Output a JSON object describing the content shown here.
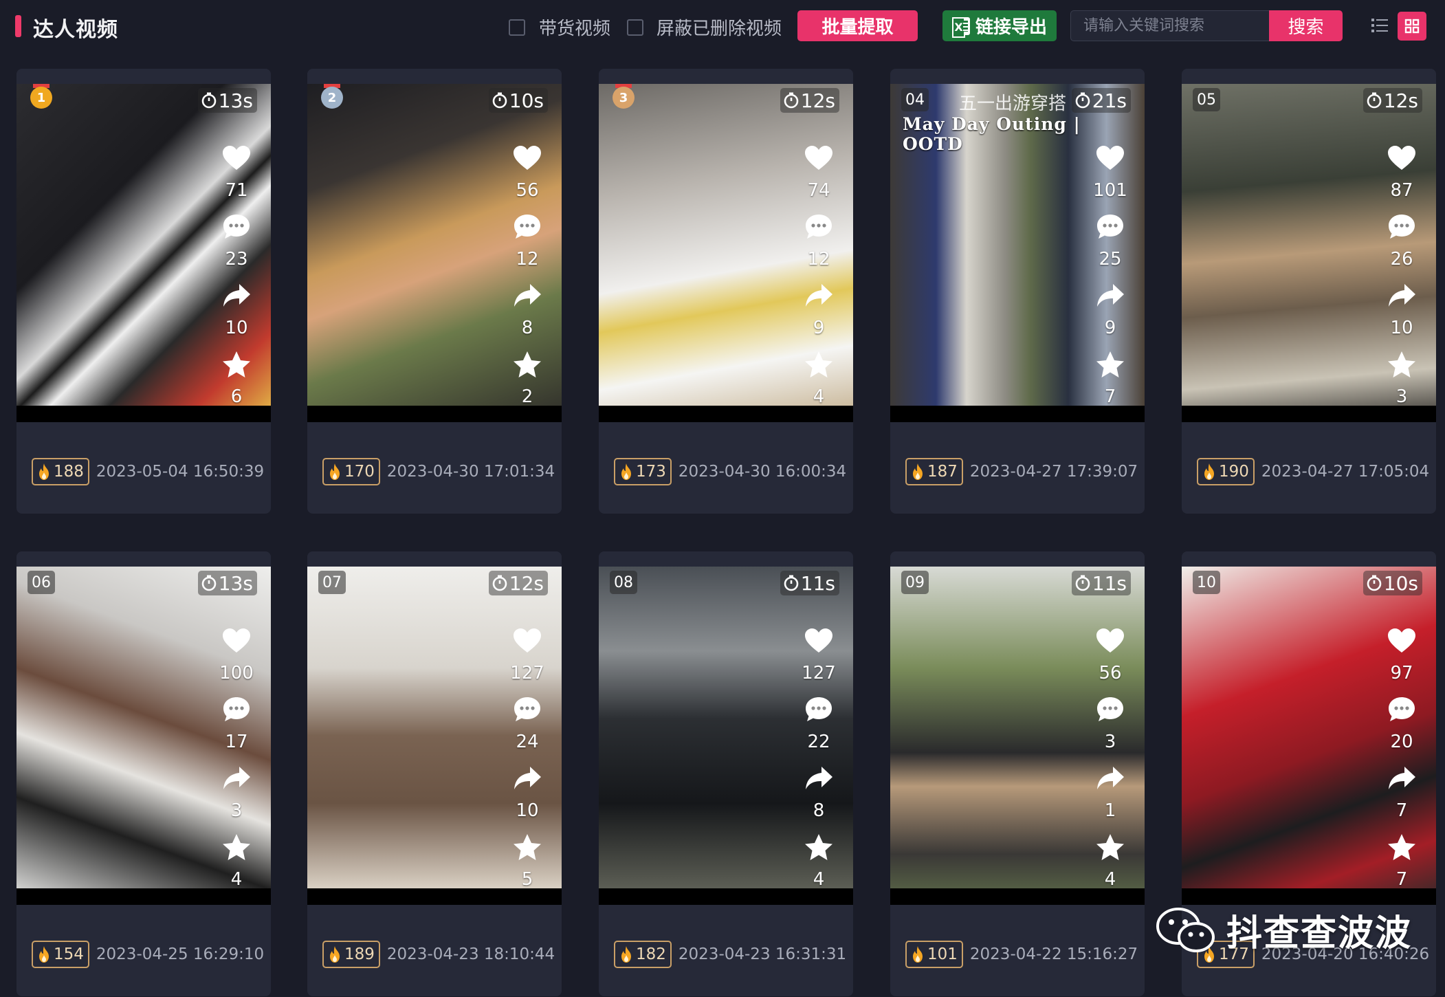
{
  "header": {
    "title": "达人视频",
    "filter_goods": "带货视频",
    "filter_deleted": "屏蔽已删除视频",
    "batch_button": "批量提取",
    "export_button": "链接导出",
    "search_placeholder": "请输入关键词搜索",
    "search_button": "搜索"
  },
  "colors": {
    "accent": "#e8336a",
    "export_green": "#1f7a3c",
    "background": "#1a1c28",
    "card": "#262938",
    "heat_border": "#caa067"
  },
  "videos": [
    {
      "rank": "1",
      "duration": "13s",
      "likes": "71",
      "comments": "23",
      "shares": "10",
      "favorites": "6",
      "heat": "188",
      "time": "2023-05-04 16:50:39"
    },
    {
      "rank": "2",
      "duration": "10s",
      "likes": "56",
      "comments": "12",
      "shares": "8",
      "favorites": "2",
      "heat": "170",
      "time": "2023-04-30 17:01:34"
    },
    {
      "rank": "3",
      "duration": "12s",
      "likes": "74",
      "comments": "12",
      "shares": "9",
      "favorites": "4",
      "heat": "173",
      "time": "2023-04-30 16:00:34"
    },
    {
      "rank": "04",
      "duration": "21s",
      "likes": "101",
      "comments": "25",
      "shares": "9",
      "favorites": "7",
      "heat": "187",
      "time": "2023-04-27 17:39:07",
      "overlay_text": "五一出游穿搭",
      "overlay_title": "May Day Outing | OOTD"
    },
    {
      "rank": "05",
      "duration": "12s",
      "likes": "87",
      "comments": "26",
      "shares": "10",
      "favorites": "3",
      "heat": "190",
      "time": "2023-04-27 17:05:04"
    },
    {
      "rank": "06",
      "duration": "13s",
      "likes": "100",
      "comments": "17",
      "shares": "3",
      "favorites": "4",
      "heat": "154",
      "time": "2023-04-25 16:29:10"
    },
    {
      "rank": "07",
      "duration": "12s",
      "likes": "127",
      "comments": "24",
      "shares": "10",
      "favorites": "5",
      "heat": "189",
      "time": "2023-04-23 18:10:44"
    },
    {
      "rank": "08",
      "duration": "11s",
      "likes": "127",
      "comments": "22",
      "shares": "8",
      "favorites": "4",
      "heat": "182",
      "time": "2023-04-23 16:31:31"
    },
    {
      "rank": "09",
      "duration": "11s",
      "likes": "56",
      "comments": "3",
      "shares": "1",
      "favorites": "4",
      "heat": "101",
      "time": "2023-04-22 15:16:27"
    },
    {
      "rank": "10",
      "duration": "10s",
      "likes": "97",
      "comments": "20",
      "shares": "7",
      "favorites": "7",
      "heat": "177",
      "time": "2023-04-20 16:40:26"
    }
  ],
  "watermark": {
    "text": "抖查查波波",
    "icon": "wechat-icon"
  }
}
